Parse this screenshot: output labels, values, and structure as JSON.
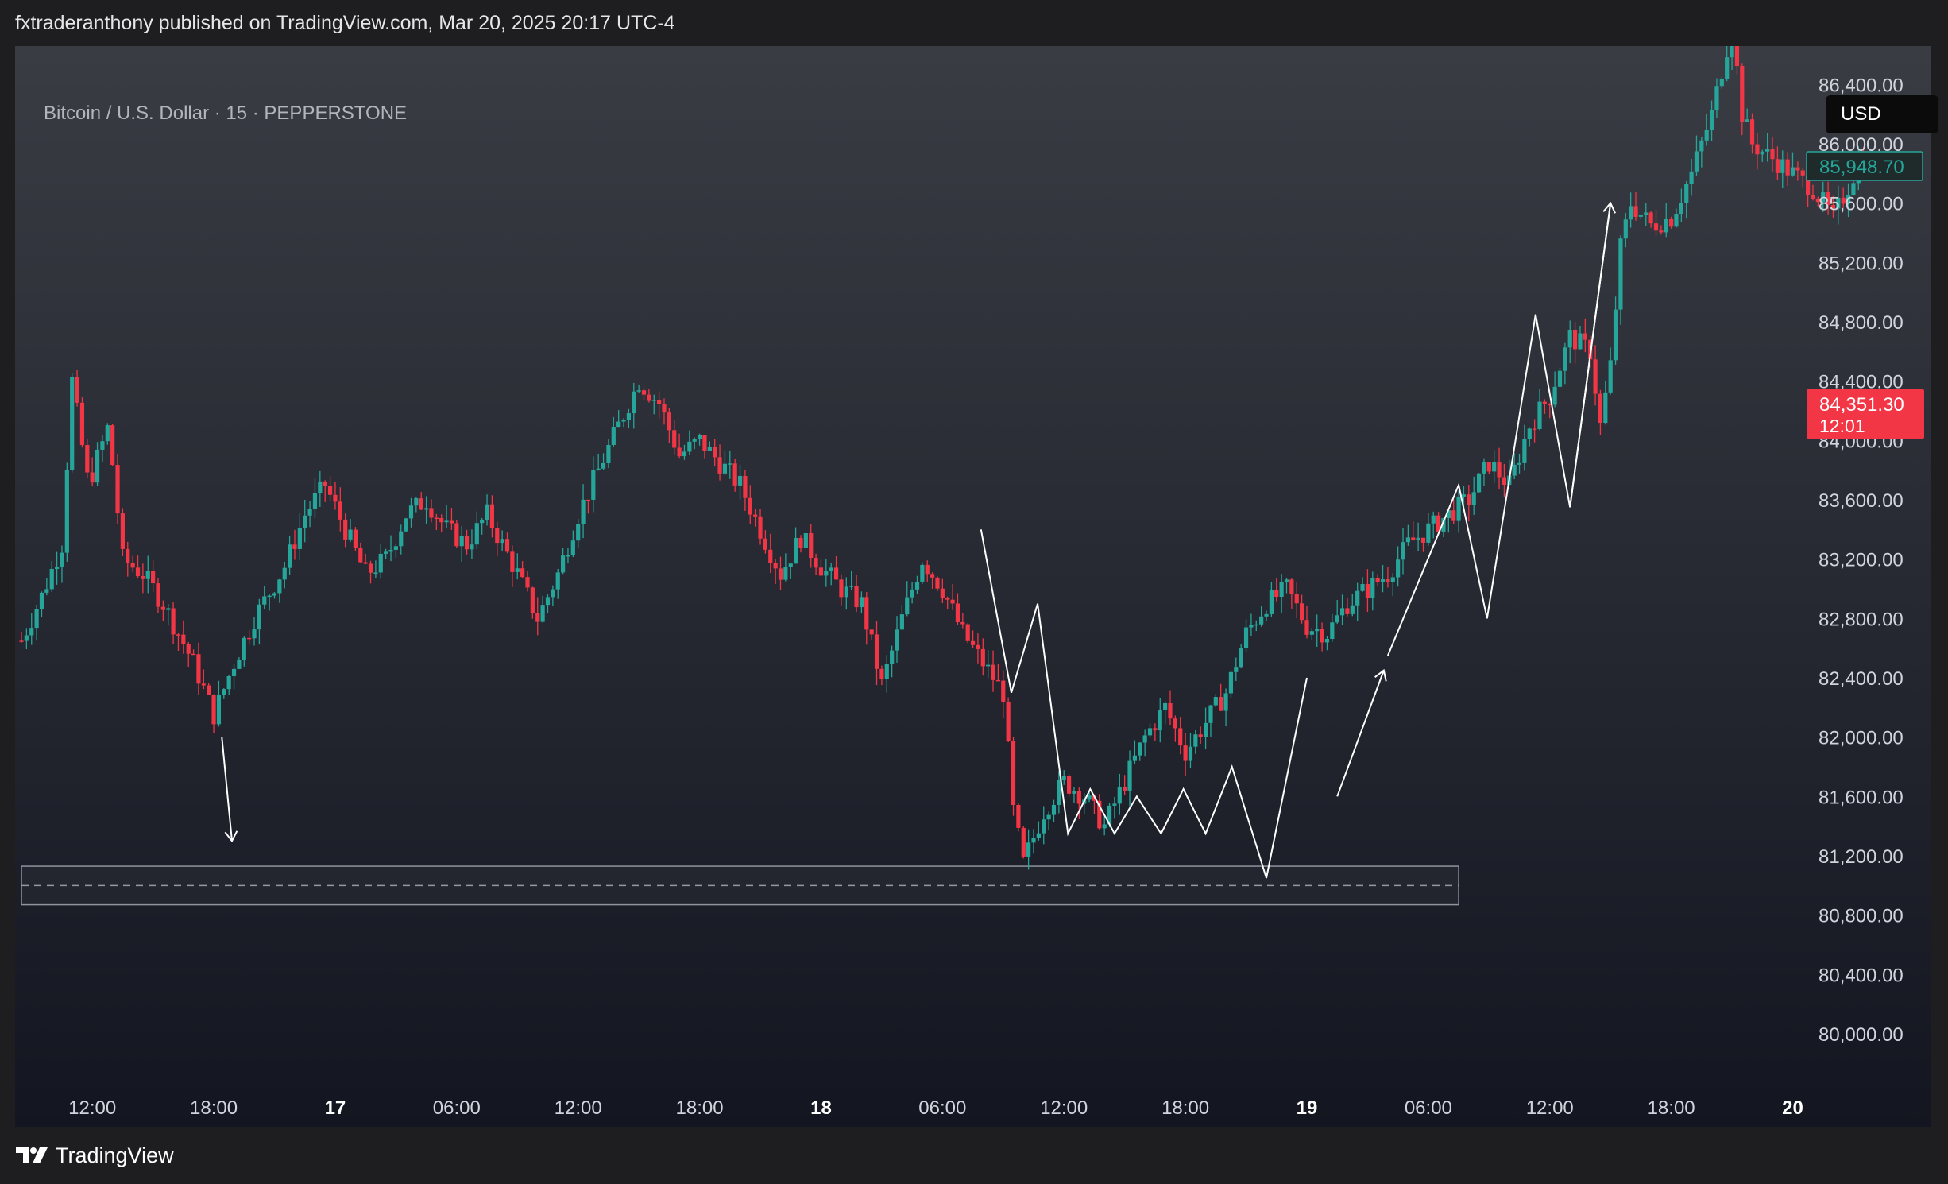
{
  "header": {
    "publish_line": "fxtraderanthony published on TradingView.com, Mar 20, 2025 20:17 UTC-4"
  },
  "symbol": {
    "title": "Bitcoin / U.S. Dollar · 15 · PEPPERSTONE"
  },
  "currency_button": "USD",
  "price_tags": {
    "high": "85,948.70",
    "last_price": "84,351.30",
    "countdown": "12:01",
    "high_color": "#26a69a",
    "last_color": "#f23645"
  },
  "footer": {
    "brand": "TradingView"
  },
  "colors": {
    "up": "#26a69a",
    "down": "#f23645",
    "drawing": "#ffffff",
    "bg_top": "#3a3c44",
    "bg_bottom": "#131620"
  },
  "chart_data": {
    "type": "candlestick",
    "title": "Bitcoin / U.S. Dollar · 15 · PEPPERSTONE",
    "ylim": [
      79700,
      86800
    ],
    "y_ticks": [
      80000,
      80400,
      80800,
      81200,
      81600,
      82000,
      82400,
      82800,
      83200,
      83600,
      84000,
      84400,
      84800,
      85200,
      85600,
      86000,
      86400
    ],
    "y_tick_labels": [
      "80,000.00",
      "80,400.00",
      "80,800.00",
      "81,200.00",
      "81,600.00",
      "82,000.00",
      "82,400.00",
      "82,800.00",
      "83,200.00",
      "83,600.00",
      "84,000.00",
      "84,400.00",
      "84,800.00",
      "85,200.00",
      "85,600.00",
      "86,000.00",
      "86,400.00"
    ],
    "x_start": "Mar 16 08:30",
    "x_end": "Mar 20 19:00",
    "x_ticks": [
      {
        "label": "12:00",
        "hours": 12,
        "bold": false
      },
      {
        "label": "18:00",
        "hours": 18,
        "bold": false
      },
      {
        "label": "17",
        "hours": 24,
        "bold": true
      },
      {
        "label": "06:00",
        "hours": 30,
        "bold": false
      },
      {
        "label": "12:00",
        "hours": 36,
        "bold": false
      },
      {
        "label": "18:00",
        "hours": 42,
        "bold": false
      },
      {
        "label": "18",
        "hours": 48,
        "bold": true
      },
      {
        "label": "06:00",
        "hours": 54,
        "bold": false
      },
      {
        "label": "12:00",
        "hours": 60,
        "bold": false
      },
      {
        "label": "18:00",
        "hours": 66,
        "bold": false
      },
      {
        "label": "19",
        "hours": 72,
        "bold": true
      },
      {
        "label": "06:00",
        "hours": 78,
        "bold": false
      },
      {
        "label": "12:00",
        "hours": 84,
        "bold": false
      },
      {
        "label": "18:00",
        "hours": 90,
        "bold": false
      },
      {
        "label": "20",
        "hours": 96,
        "bold": true
      }
    ],
    "price_path": [
      [
        8.5,
        82650
      ],
      [
        9.5,
        82950
      ],
      [
        10.5,
        83300
      ],
      [
        11.0,
        84400
      ],
      [
        11.8,
        83700
      ],
      [
        12.8,
        84100
      ],
      [
        13.5,
        83200
      ],
      [
        14.5,
        83100
      ],
      [
        15.5,
        82900
      ],
      [
        17.0,
        82500
      ],
      [
        18.0,
        82150
      ],
      [
        19.0,
        82500
      ],
      [
        20.0,
        82800
      ],
      [
        21.5,
        83150
      ],
      [
        22.5,
        83500
      ],
      [
        23.5,
        83700
      ],
      [
        24.5,
        83400
      ],
      [
        25.5,
        83100
      ],
      [
        26.5,
        83200
      ],
      [
        27.5,
        83500
      ],
      [
        28.5,
        83600
      ],
      [
        29.5,
        83400
      ],
      [
        30.5,
        83300
      ],
      [
        31.5,
        83500
      ],
      [
        33.0,
        83100
      ],
      [
        34.0,
        82800
      ],
      [
        35.0,
        83100
      ],
      [
        36.0,
        83500
      ],
      [
        37.0,
        83800
      ],
      [
        38.0,
        84100
      ],
      [
        39.0,
        84400
      ],
      [
        40.0,
        84250
      ],
      [
        41.0,
        83900
      ],
      [
        42.0,
        84000
      ],
      [
        43.0,
        83850
      ],
      [
        44.0,
        83700
      ],
      [
        45.0,
        83400
      ],
      [
        46.0,
        83100
      ],
      [
        47.0,
        83350
      ],
      [
        48.0,
        83150
      ],
      [
        49.0,
        83000
      ],
      [
        50.0,
        82900
      ],
      [
        51.0,
        82350
      ],
      [
        52.0,
        82800
      ],
      [
        53.0,
        83200
      ],
      [
        54.0,
        83000
      ],
      [
        55.0,
        82700
      ],
      [
        56.0,
        82500
      ],
      [
        57.0,
        82300
      ],
      [
        57.5,
        81500
      ],
      [
        58.0,
        81150
      ],
      [
        59.0,
        81500
      ],
      [
        60.0,
        81700
      ],
      [
        61.0,
        81600
      ],
      [
        62.0,
        81400
      ],
      [
        63.0,
        81700
      ],
      [
        64.0,
        82000
      ],
      [
        65.0,
        82200
      ],
      [
        66.0,
        81900
      ],
      [
        67.0,
        82100
      ],
      [
        68.0,
        82300
      ],
      [
        69.0,
        82700
      ],
      [
        70.0,
        82900
      ],
      [
        71.0,
        83000
      ],
      [
        72.0,
        82750
      ],
      [
        73.0,
        82700
      ],
      [
        74.0,
        82900
      ],
      [
        75.0,
        83000
      ],
      [
        76.0,
        83100
      ],
      [
        77.0,
        83300
      ],
      [
        78.0,
        83400
      ],
      [
        79.0,
        83500
      ],
      [
        80.0,
        83600
      ],
      [
        81.0,
        83850
      ],
      [
        82.0,
        83700
      ],
      [
        83.0,
        84100
      ],
      [
        84.0,
        84300
      ],
      [
        85.0,
        84700
      ],
      [
        86.0,
        84600
      ],
      [
        86.5,
        84100
      ],
      [
        87.0,
        84500
      ],
      [
        87.5,
        85300
      ],
      [
        88.0,
        85600
      ],
      [
        89.0,
        85450
      ],
      [
        90.0,
        85500
      ],
      [
        91.0,
        85800
      ],
      [
        92.0,
        86200
      ],
      [
        93.0,
        86800
      ],
      [
        93.5,
        86200
      ],
      [
        94.0,
        86000
      ],
      [
        95.0,
        85900
      ],
      [
        96.0,
        85800
      ],
      [
        97.0,
        85700
      ],
      [
        98.0,
        85500
      ],
      [
        98.7,
        85700
      ],
      [
        99.5,
        85950
      ]
    ],
    "support_zone": {
      "from_hours": 8.5,
      "to_hours": 79.5,
      "top": 81130,
      "bottom": 80870,
      "mid": 81000
    },
    "drawings": {
      "arrow_down": [
        [
          18.4,
          82000
        ],
        [
          18.9,
          81300
        ]
      ],
      "zigzag_mid": [
        [
          55.9,
          83400
        ],
        [
          57.4,
          82300
        ],
        [
          58.7,
          82900
        ],
        [
          60.2,
          81350
        ],
        [
          61.3,
          81650
        ],
        [
          62.5,
          81350
        ],
        [
          63.6,
          81600
        ],
        [
          64.8,
          81350
        ],
        [
          65.9,
          81650
        ],
        [
          67.0,
          81350
        ],
        [
          68.3,
          81800
        ],
        [
          70.0,
          81050
        ],
        [
          72.0,
          82400
        ]
      ],
      "zigzag_up": [
        [
          73.5,
          81600
        ],
        [
          75.8,
          82450
        ]
      ],
      "zigzag_big": [
        [
          76.0,
          82550
        ],
        [
          79.5,
          83700
        ],
        [
          80.9,
          82800
        ],
        [
          83.3,
          84850
        ],
        [
          85.0,
          83550
        ],
        [
          87.0,
          85600
        ]
      ]
    }
  }
}
